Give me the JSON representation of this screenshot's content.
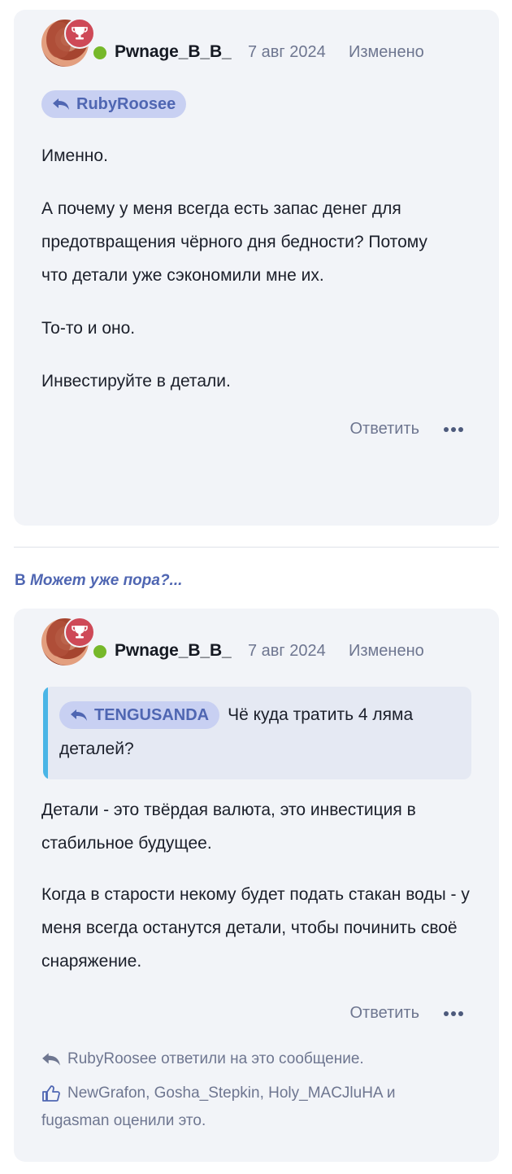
{
  "posts": [
    {
      "author": "Pwnage_B_B_",
      "date": "7 авг 2024",
      "edited_label": "Изменено",
      "reply_to": "RubyRoosee",
      "paragraphs": [
        "Именно.",
        "А почему у меня всегда есть запас денег для предотвращения чёрного дня бедности? Потому что детали уже сэкономили мне их.",
        "То-то и оно.",
        "Инвестируйте в детали."
      ],
      "reply_label": "Ответить",
      "more_icon": "ellipsis-icon"
    },
    {
      "thread_prefix": "В",
      "thread_title": "Может уже пора?...",
      "author": "Pwnage_B_B_",
      "date": "7 авг 2024",
      "edited_label": "Изменено",
      "quote_author": "TENGUSANDA",
      "quote_text": "Чё куда тратить 4 ляма деталей?",
      "paragraphs": [
        "Детали - это твёрдая валюта, это инвестиция в стабильное будущее.",
        "Когда в старости некому будет подать стакан воды - у меня всегда останутся детали, чтобы починить своё снаряжение."
      ],
      "reply_label": "Ответить",
      "replied_note": "RubyRoosee ответили на это сообщение.",
      "likes_note": "NewGrafon, Gosha_Stepkin, Holy_MACJluHA и fugasman оценили это."
    }
  ],
  "colors": {
    "accent": "#4f66b2",
    "card_bg": "#f2f4f8",
    "muted": "#6e7690",
    "online": "#76b82a",
    "badge": "#ce4957",
    "quote_bar": "#4ab5e6"
  }
}
